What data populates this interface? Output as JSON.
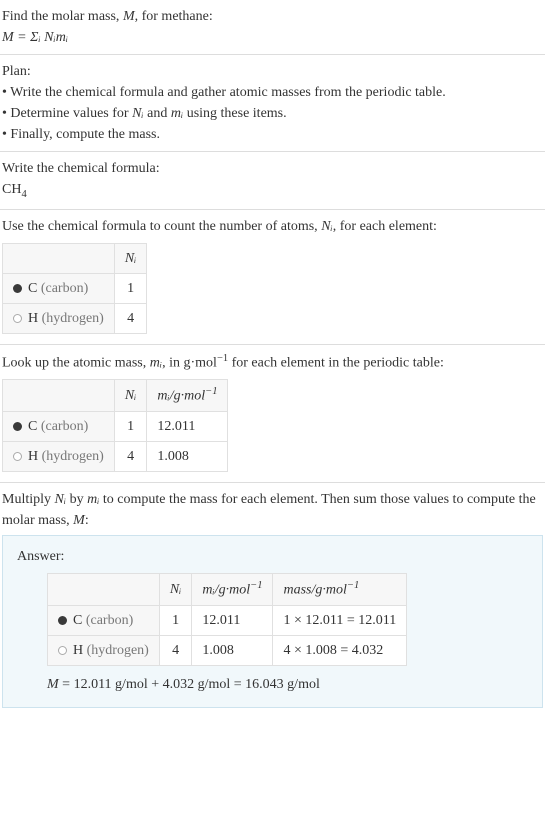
{
  "intro": {
    "line1_pre": "Find the molar mass, ",
    "line1_var": "M",
    "line1_post": ", for methane:",
    "eq_lhs": "M",
    "eq_rhs": " = Σᵢ Nᵢmᵢ"
  },
  "plan": {
    "heading": "Plan:",
    "b1_pre": "• Write the chemical formula and gather atomic masses from the periodic table.",
    "b2_pre": "• Determine values for ",
    "b2_n": "Nᵢ",
    "b2_mid": " and ",
    "b2_m": "mᵢ",
    "b2_post": " using these items.",
    "b3": "• Finally, compute the mass."
  },
  "formula": {
    "heading": "Write the chemical formula:",
    "chem_base": "CH",
    "chem_sub": "4"
  },
  "count": {
    "text_pre": "Use the chemical formula to count the number of atoms, ",
    "text_var": "Nᵢ",
    "text_post": ", for each element:",
    "col_n": "Nᵢ",
    "rows": [
      {
        "dot": "dot-c",
        "sym": "C",
        "name": "(carbon)",
        "n": "1"
      },
      {
        "dot": "dot-h",
        "sym": "H",
        "name": "(hydrogen)",
        "n": "4"
      }
    ]
  },
  "mass": {
    "text_pre": "Look up the atomic mass, ",
    "text_var": "mᵢ",
    "text_mid": ", in g·mol",
    "text_exp": "−1",
    "text_post": " for each element in the periodic table:",
    "col_n": "Nᵢ",
    "col_m_pre": "mᵢ",
    "col_m_mid": "/g·mol",
    "col_m_exp": "−1",
    "rows": [
      {
        "dot": "dot-c",
        "sym": "C",
        "name": "(carbon)",
        "n": "1",
        "m": "12.011"
      },
      {
        "dot": "dot-h",
        "sym": "H",
        "name": "(hydrogen)",
        "n": "4",
        "m": "1.008"
      }
    ]
  },
  "compute": {
    "text_pre": "Multiply ",
    "text_n": "Nᵢ",
    "text_mid1": " by ",
    "text_m": "mᵢ",
    "text_mid2": " to compute the mass for each element. Then sum those values to compute the molar mass, ",
    "text_M": "M",
    "text_post": ":"
  },
  "answer": {
    "label": "Answer:",
    "col_n": "Nᵢ",
    "col_m_pre": "mᵢ",
    "col_m_mid": "/g·mol",
    "col_m_exp": "−1",
    "col_mass_pre": "mass/g·mol",
    "col_mass_exp": "−1",
    "rows": [
      {
        "dot": "dot-c",
        "sym": "C",
        "name": "(carbon)",
        "n": "1",
        "m": "12.011",
        "mass": "1 × 12.011 = 12.011"
      },
      {
        "dot": "dot-h",
        "sym": "H",
        "name": "(hydrogen)",
        "n": "4",
        "m": "1.008",
        "mass": "4 × 1.008 = 4.032"
      }
    ],
    "final_lhs": "M",
    "final_rhs": " = 12.011 g/mol + 4.032 g/mol = 16.043 g/mol"
  }
}
